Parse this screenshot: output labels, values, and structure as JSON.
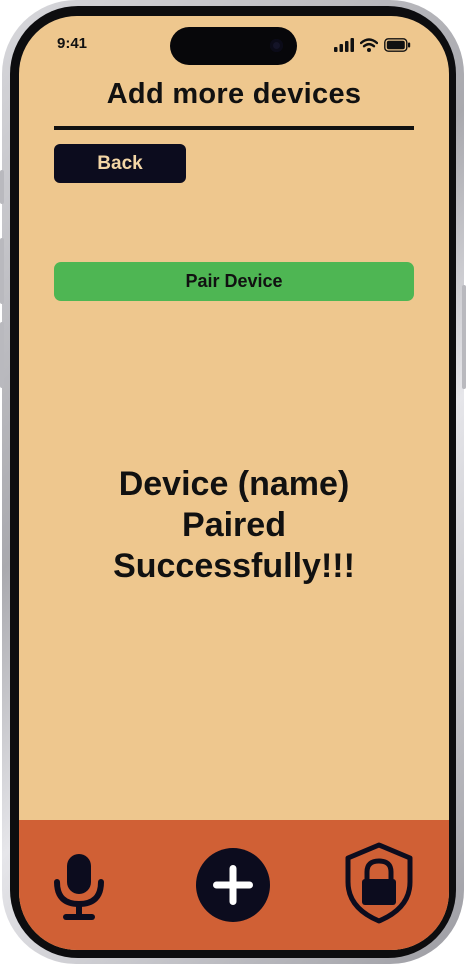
{
  "status_bar": {
    "time": "9:41"
  },
  "header": {
    "title": "Add more devices"
  },
  "buttons": {
    "back": "Back",
    "pair": "Pair Device"
  },
  "main": {
    "message_line1": "Device (name)",
    "message_line2": "Paired",
    "message_line3": "Successfully!!!"
  },
  "bottom_nav": {
    "items": [
      "microphone-icon",
      "add-icon",
      "lock-shield-icon"
    ]
  },
  "colors": {
    "background": "#eec78e",
    "bottom_bar": "#d06035",
    "pair_button": "#4eb653",
    "dark": "#0c0c1e",
    "back_text": "#f3d6a6"
  }
}
